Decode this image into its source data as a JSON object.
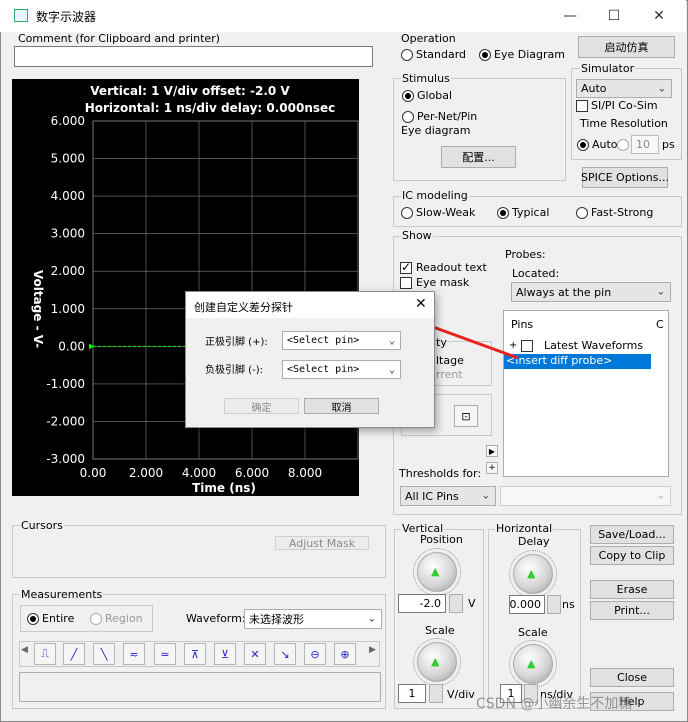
{
  "window": {
    "title": "数字示波器",
    "min": "—",
    "max": "☐",
    "close": "✕"
  },
  "comment": {
    "label": "Comment (for Clipboard and printer)",
    "value": ""
  },
  "scope": {
    "header_line1": "Vertical: 1  V/div  offset: -2.0 V",
    "header_line2": "Horizontal: 1 ns/div  delay: 0.000nsec",
    "ylabel": "Voltage - V-",
    "xlabel": "Time  (ns)",
    "yticks": [
      "6.000",
      "5.000",
      "4.000",
      "3.000",
      "2.000",
      "1.000",
      "0.00",
      "-1.000",
      "-2.000",
      "-3.000"
    ],
    "xticks": [
      "0.00",
      "2.000",
      "4.000",
      "6.000",
      "8.000"
    ],
    "colors": {
      "bg": "#000000",
      "grid": "#808080",
      "text": "#ffffff",
      "trace": "#00ff00"
    }
  },
  "operation": {
    "title": "Operation",
    "standard": "Standard",
    "eye": "Eye Diagram",
    "selected": "Eye Diagram"
  },
  "simulate_button": "启动仿真",
  "simulator": {
    "title": "Simulator",
    "value": "Auto",
    "cosim": "SI/PI Co-Sim",
    "res_title": "Time Resolution",
    "auto": "Auto",
    "res_value": "10",
    "res_unit": "ps"
  },
  "stimulus": {
    "title": "Stimulus",
    "global": "Global",
    "pernet": "Per-Net/Pin",
    "eye_title": "Eye diagram",
    "config_button": "配置..."
  },
  "spice_button": "SPICE Options...",
  "ic_modeling": {
    "title": "IC modeling",
    "slow": "Slow-Weak",
    "typical": "Typical",
    "fast": "Fast-Strong",
    "selected": "Typical"
  },
  "show": {
    "title": "Show",
    "readout": "Readout text",
    "eyemask": "Eye mask",
    "probes_title": "Probes:",
    "located": "Located:",
    "located_value": "Always at the pin",
    "pins_header": "Pins",
    "pins_col2": "C",
    "latest": "Latest Waveforms",
    "insert_diff": "<Insert diff probe>",
    "partial_ty": "ty",
    "partial_ltage": "ltage",
    "partial_rrent": "rrent",
    "thresholds_label": "Thresholds for:",
    "thresholds_value": "All IC Pins"
  },
  "cursors": {
    "title": "Cursors",
    "adjust": "Adjust Mask"
  },
  "measurements": {
    "title": "Measurements",
    "entire": "Entire",
    "region": "Region",
    "waveform_label": "Waveform:",
    "waveform_value": "未选择波形"
  },
  "vertical": {
    "title": "Vertical",
    "position": "Position",
    "pos_value": "-2.0",
    "pos_unit": "V",
    "scale": "Scale",
    "scale_value": "1",
    "scale_unit": "V/div"
  },
  "horizontal": {
    "title": "Horizontal",
    "delay": "Delay",
    "delay_value": "0.000",
    "delay_unit": "ns",
    "scale": "Scale",
    "scale_value": "1",
    "scale_unit": "ns/div"
  },
  "side_buttons": {
    "saveload": "Save/Load...",
    "copy": "Copy to Clip",
    "erase": "Erase",
    "print": "Print...",
    "close": "Close",
    "help": "Help"
  },
  "dialog": {
    "title": "创建自定义差分探针",
    "pos_label": "正极引脚 (+):",
    "neg_label": "负极引脚 (-):",
    "pos_value": "<Select pin>",
    "neg_value": "<Select pin>",
    "ok": "确定",
    "cancel": "取消"
  },
  "annotation_color": "#e8231c",
  "watermark": "CSDN @小幽余生不加糖"
}
